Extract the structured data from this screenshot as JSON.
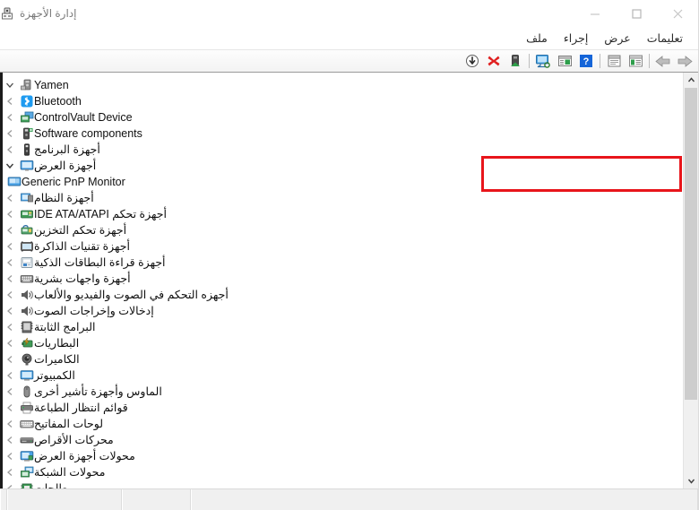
{
  "window": {
    "title": "إدارة الأجهزة",
    "app_icon": "device-manager-icon",
    "controls": {
      "close": "✕",
      "maximize": "☐",
      "minimize": "—"
    }
  },
  "menu": {
    "items": [
      {
        "label": "ملف",
        "name": "menu-file"
      },
      {
        "label": "إجراء",
        "name": "menu-action"
      },
      {
        "label": "عرض",
        "name": "menu-view"
      },
      {
        "label": "تعليمات",
        "name": "menu-help"
      }
    ]
  },
  "toolbar": {
    "buttons": [
      {
        "name": "forward-button",
        "icon": "arrow-right-icon"
      },
      {
        "name": "back-button",
        "icon": "arrow-left-icon"
      },
      {
        "name": "show-hidden-devices-button",
        "icon": "window-list-icon"
      },
      {
        "name": "properties-button",
        "icon": "properties-window-icon"
      },
      {
        "name": "help-button",
        "icon": "help-question-icon"
      },
      {
        "name": "device-details-button",
        "icon": "window-details-icon"
      },
      {
        "name": "scan-hardware-changes-button",
        "icon": "monitor-scan-icon"
      },
      {
        "name": "update-driver-button",
        "icon": "update-driver-icon"
      },
      {
        "name": "uninstall-device-button",
        "icon": "red-x-icon"
      },
      {
        "name": "disable-device-button",
        "icon": "down-arrow-circle-icon"
      }
    ]
  },
  "tree": {
    "root": {
      "label": "Yamen",
      "icon": "computer-tower-icon",
      "expanded": true,
      "level": 0,
      "chevron": "chevron-down-icon"
    },
    "items": [
      {
        "label": "Bluetooth",
        "icon": "bluetooth-icon",
        "level": 1,
        "chevron": "chevron-collapsed-icon",
        "latin": true
      },
      {
        "label": "ControlVault Device",
        "icon": "controlvault-icon",
        "level": 1,
        "chevron": "chevron-collapsed-icon",
        "latin": true
      },
      {
        "label": "Software components",
        "icon": "software-component-icon",
        "level": 1,
        "chevron": "chevron-collapsed-icon",
        "latin": true
      },
      {
        "label": "أجهزة البرنامج",
        "icon": "software-device-icon",
        "level": 1,
        "chevron": "chevron-collapsed-icon",
        "latin": false
      },
      {
        "label": "أجهزة العرض",
        "icon": "monitor-icon",
        "level": 1,
        "chevron": "chevron-down-icon",
        "latin": false,
        "highlighted": true
      },
      {
        "label": "Generic PnP Monitor",
        "icon": "monitor-small-icon",
        "level": 2,
        "chevron": "none",
        "latin": true,
        "highlighted": true
      },
      {
        "label": "أجهزة النظام",
        "icon": "system-device-icon",
        "level": 1,
        "chevron": "chevron-collapsed-icon",
        "latin": false
      },
      {
        "label": "أجهزة تحكم IDE ATA/ATAPI",
        "icon": "ide-controller-icon",
        "level": 1,
        "chevron": "chevron-collapsed-icon",
        "latin": false
      },
      {
        "label": "أجهزة تحكم التخزين",
        "icon": "storage-controller-icon",
        "level": 1,
        "chevron": "chevron-collapsed-icon",
        "latin": false
      },
      {
        "label": "أجهزة تقنيات الذاكرة",
        "icon": "memory-tech-icon",
        "level": 1,
        "chevron": "chevron-collapsed-icon",
        "latin": false
      },
      {
        "label": "أجهزة قراءة البطاقات الذكية",
        "icon": "smartcard-reader-icon",
        "level": 1,
        "chevron": "chevron-collapsed-icon",
        "latin": false
      },
      {
        "label": "أجهزة واجهات بشرية",
        "icon": "hid-icon",
        "level": 1,
        "chevron": "chevron-collapsed-icon",
        "latin": false
      },
      {
        "label": "أجهزه التحكم في الصوت والفيديو والألعاب",
        "icon": "sound-video-game-icon",
        "level": 1,
        "chevron": "chevron-collapsed-icon",
        "latin": false
      },
      {
        "label": "إدخالات وإخراجات الصوت",
        "icon": "audio-io-icon",
        "level": 1,
        "chevron": "chevron-collapsed-icon",
        "latin": false
      },
      {
        "label": "البرامج الثابتة",
        "icon": "firmware-icon",
        "level": 1,
        "chevron": "chevron-collapsed-icon",
        "latin": false
      },
      {
        "label": "البطاريات",
        "icon": "battery-icon",
        "level": 1,
        "chevron": "chevron-collapsed-icon",
        "latin": false
      },
      {
        "label": "الكاميرات",
        "icon": "camera-icon",
        "level": 1,
        "chevron": "chevron-collapsed-icon",
        "latin": false
      },
      {
        "label": "الكمبيوتر",
        "icon": "computer-icon",
        "level": 1,
        "chevron": "chevron-collapsed-icon",
        "latin": false
      },
      {
        "label": "الماوس وأجهزة تأشير أخرى",
        "icon": "mouse-icon",
        "level": 1,
        "chevron": "chevron-collapsed-icon",
        "latin": false
      },
      {
        "label": "قوائم انتظار الطباعة",
        "icon": "print-queue-icon",
        "level": 1,
        "chevron": "chevron-collapsed-icon",
        "latin": false
      },
      {
        "label": "لوحات المفاتيح",
        "icon": "keyboard-icon",
        "level": 1,
        "chevron": "chevron-collapsed-icon",
        "latin": false
      },
      {
        "label": "محركات الأقراص",
        "icon": "disk-drive-icon",
        "level": 1,
        "chevron": "chevron-collapsed-icon",
        "latin": false
      },
      {
        "label": "محولات أجهزة العرض",
        "icon": "display-adapter-icon",
        "level": 1,
        "chevron": "chevron-collapsed-icon",
        "latin": false
      },
      {
        "label": "محولات الشبكة",
        "icon": "network-adapter-icon",
        "level": 1,
        "chevron": "chevron-collapsed-icon",
        "latin": false
      },
      {
        "label": "معالجات",
        "icon": "processor-icon",
        "level": 1,
        "chevron": "chevron-collapsed-icon",
        "latin": false
      }
    ]
  },
  "highlight": {
    "color": "#e8151b",
    "target": "أجهزة العرض / Generic PnP Monitor"
  },
  "statusbar": {
    "panes": [
      "",
      "",
      "",
      ""
    ]
  },
  "colors": {
    "accent_red": "#e8151b",
    "bluetooth_blue": "#2196f3",
    "window_bg": "#ffffff",
    "toolbar_bg": "#f3f3f3",
    "status_bg": "#f0f0f0",
    "scrollbar_thumb": "#cdcdcd"
  }
}
